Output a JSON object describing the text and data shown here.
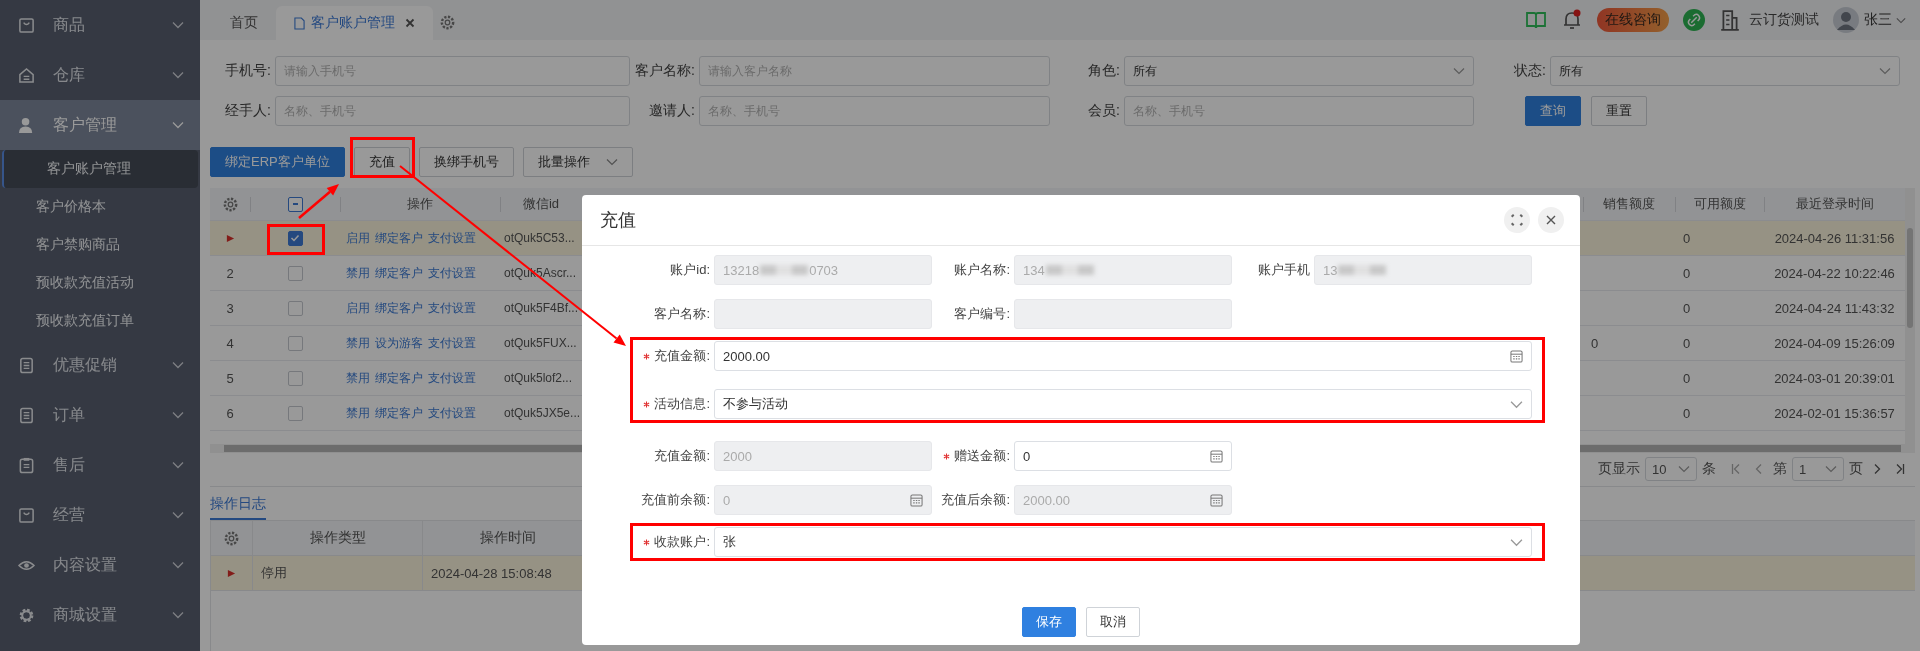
{
  "sidebar": {
    "items": [
      {
        "label": "商品",
        "selected": false
      },
      {
        "label": "仓库",
        "selected": false
      },
      {
        "label": "客户管理",
        "selected": true,
        "children": [
          {
            "label": "客户账户管理",
            "selected": true
          },
          {
            "label": "客户价格本",
            "selected": false
          },
          {
            "label": "客户禁购商品",
            "selected": false
          },
          {
            "label": "预收款充值活动",
            "selected": false
          },
          {
            "label": "预收款充值订单",
            "selected": false
          }
        ]
      },
      {
        "label": "优惠促销",
        "selected": false
      },
      {
        "label": "订单",
        "selected": false
      },
      {
        "label": "售后",
        "selected": false
      },
      {
        "label": "经营",
        "selected": false
      },
      {
        "label": "内容设置",
        "selected": false
      },
      {
        "label": "商城设置",
        "selected": false
      }
    ]
  },
  "tabs": [
    {
      "label": "首页",
      "selected": false,
      "closable": false
    },
    {
      "label": "客户账户管理",
      "selected": true,
      "closable": true
    }
  ],
  "header": {
    "unread": true,
    "consult_label": "在线咨询",
    "company": "云订货测试",
    "user": "张三"
  },
  "filters": [
    {
      "label": "手机号:",
      "kind": "input",
      "placeholder": "请输入手机号"
    },
    {
      "label": "客户名称:",
      "kind": "input",
      "placeholder": "请输入客户名称"
    },
    {
      "label": "角色:",
      "kind": "select",
      "value": "所有"
    },
    {
      "label": "状态:",
      "kind": "select",
      "value": "所有"
    },
    {
      "label": "经手人:",
      "kind": "input",
      "placeholder": "名称、手机号"
    },
    {
      "label": "邀请人:",
      "kind": "input",
      "placeholder": "名称、手机号"
    },
    {
      "label": "会员:",
      "kind": "input",
      "placeholder": "名称、手机号"
    }
  ],
  "filter_buttons": [
    {
      "label": "查询",
      "kind": "primary"
    },
    {
      "label": "重置",
      "kind": "default"
    }
  ],
  "toolbar": [
    {
      "label": "绑定ERP客户单位",
      "kind": "primary",
      "highlighted": false
    },
    {
      "label": "充值",
      "kind": "default",
      "highlighted": true
    },
    {
      "label": "换绑手机号",
      "kind": "default",
      "highlighted": false
    },
    {
      "label": "批量操作",
      "kind": "dropdown",
      "highlighted": false
    }
  ],
  "table": {
    "select_all": {
      "indeterminate": true
    },
    "columns": [
      "操作",
      "微信id",
      "销售额度",
      "可用额度",
      "最近登录时间"
    ],
    "rows": [
      {
        "current": true,
        "checked": true,
        "highlighted": true,
        "actions": [
          "启用",
          "绑定客户",
          "支付设置"
        ],
        "wechat_id": "otQuk5C53...",
        "available": "0",
        "last_login": "2024-04-26 11:31:56"
      },
      {
        "current": false,
        "index": "2",
        "checked": false,
        "highlighted": false,
        "actions": [
          "禁用",
          "绑定客户",
          "支付设置"
        ],
        "wechat_id": "otQuk5Ascr...",
        "available": "0",
        "last_login": "2024-04-22 10:22:46"
      },
      {
        "current": false,
        "index": "3",
        "checked": false,
        "highlighted": false,
        "actions": [
          "启用",
          "绑定客户",
          "支付设置"
        ],
        "wechat_id": "otQuk5F4Bf...",
        "available": "0",
        "last_login": "2024-04-24 11:43:32"
      },
      {
        "current": false,
        "index": "4",
        "checked": false,
        "highlighted": false,
        "actions": [
          "禁用",
          "设为游客",
          "支付设置"
        ],
        "wechat_id": "otQuk5FUX...",
        "sales_limit": "0",
        "available": "0",
        "last_login": "2024-04-09 15:26:09"
      },
      {
        "current": false,
        "index": "5",
        "checked": false,
        "highlighted": false,
        "actions": [
          "禁用",
          "绑定客户",
          "支付设置"
        ],
        "wechat_id": "otQuk5lof2...",
        "available": "0",
        "last_login": "2024-03-01 20:39:01"
      },
      {
        "current": false,
        "index": "6",
        "checked": false,
        "highlighted": false,
        "actions": [
          "禁用",
          "绑定客户",
          "支付设置"
        ],
        "wechat_id": "otQuk5JX5e...",
        "available": "0",
        "last_login": "2024-02-01 15:36:57"
      }
    ]
  },
  "pagination": {
    "per_page_prefix": "页显示",
    "per_page": "10",
    "per_page_suffix": "条",
    "page_prefix": "第",
    "page": "1",
    "page_suffix": "页"
  },
  "log": {
    "tab": "操作日志",
    "columns": [
      "操作类型",
      "操作时间"
    ],
    "rows": [
      {
        "current": true,
        "type": "停用",
        "time": "2024-04-28 15:08:48"
      }
    ]
  },
  "dialog": {
    "title": "充值",
    "sections": [
      {
        "highlighted": false,
        "rows": [
          [
            {
              "label": "账户id:",
              "kind": "text",
              "disabled": true,
              "required": false,
              "redacted": true,
              "value": "13218",
              "value_end": "0703"
            },
            {
              "label": "账户名称:",
              "kind": "text",
              "disabled": true,
              "required": false,
              "redacted": true,
              "value": "134"
            },
            {
              "label": "账户手机",
              "kind": "text",
              "disabled": true,
              "required": false,
              "redacted": true,
              "value": "13"
            }
          ],
          [
            {
              "label": "客户名称:",
              "kind": "text",
              "disabled": true,
              "required": false,
              "redacted": false
            },
            {
              "label": "客户编号:",
              "kind": "text",
              "disabled": true,
              "required": false,
              "redacted": false
            }
          ]
        ]
      },
      {
        "highlighted": true,
        "rows": [
          [
            {
              "label": "充值金额:",
              "kind": "number",
              "disabled": false,
              "required": true,
              "redacted": false,
              "wide": true,
              "value": "2000.00"
            }
          ],
          [
            {
              "label": "活动信息:",
              "kind": "select",
              "disabled": false,
              "required": true,
              "redacted": false,
              "wide": true,
              "value": "不参与活动"
            }
          ]
        ]
      },
      {
        "highlighted": false,
        "rows": [
          [
            {
              "label": "充值金额:",
              "kind": "text",
              "disabled": true,
              "required": false,
              "redacted": false,
              "value": "2000"
            },
            {
              "label": "赠送金额:",
              "kind": "number",
              "disabled": false,
              "required": true,
              "redacted": false,
              "value": "0"
            }
          ],
          [
            {
              "label": "充值前余额:",
              "kind": "number",
              "disabled": true,
              "required": false,
              "redacted": false,
              "value": "0"
            },
            {
              "label": "充值后余额:",
              "kind": "number",
              "disabled": true,
              "required": false,
              "redacted": false,
              "value": "2000.00"
            }
          ]
        ]
      },
      {
        "highlighted": true,
        "rows": [
          [
            {
              "label": "收款账户:",
              "kind": "select",
              "disabled": false,
              "required": true,
              "redacted": false,
              "wide": true,
              "value": "张"
            }
          ]
        ]
      }
    ],
    "buttons": [
      {
        "label": "保存",
        "kind": "primary"
      },
      {
        "label": "取消",
        "kind": "default"
      }
    ]
  }
}
